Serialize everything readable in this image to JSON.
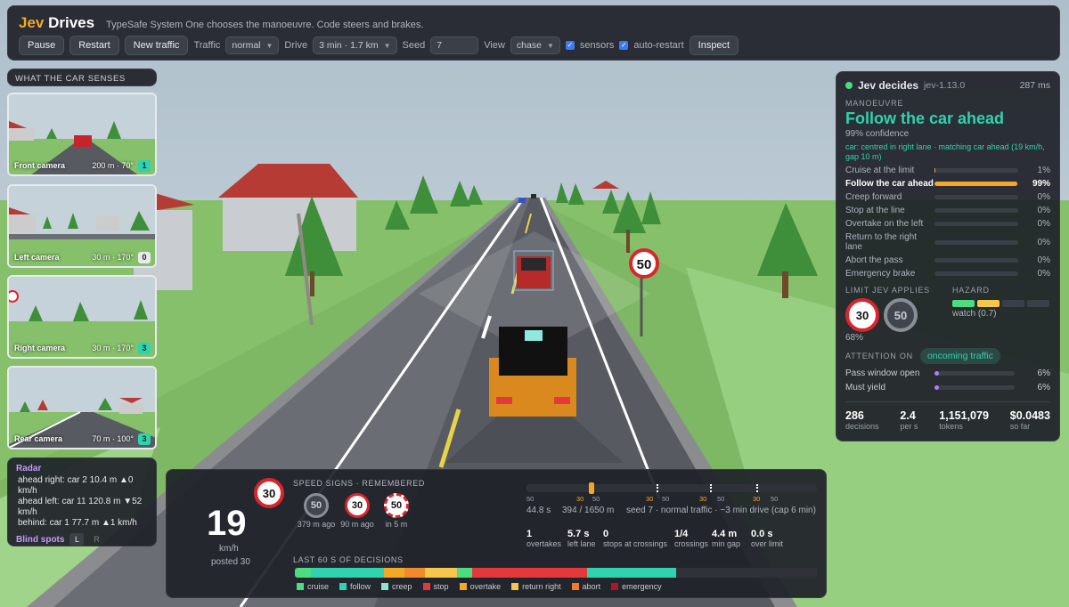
{
  "app": {
    "brand_jev": "Jev",
    "brand_drives": "Drives",
    "subtitle": "TypeSafe System One chooses the manoeuvre. Code steers and brakes."
  },
  "toolbar": {
    "pause": "Pause",
    "restart": "Restart",
    "new_traffic": "New traffic",
    "traffic_label": "Traffic",
    "traffic_value": "normal",
    "drive_label": "Drive",
    "drive_value": "3 min · 1.7 km",
    "seed_label": "Seed",
    "seed_value": "7",
    "view_label": "View",
    "view_value": "chase",
    "sensors_label": "sensors",
    "autorestart_label": "auto-restart",
    "inspect": "Inspect"
  },
  "senses": {
    "title": "WHAT THE CAR SENSES",
    "cameras": [
      {
        "label": "Front camera",
        "dist": "200 m · 70°",
        "count": "1",
        "count_color": "#2fd3b0"
      },
      {
        "label": "Left camera",
        "dist": "30 m · 170°",
        "count": "0",
        "count_color": "#e8eaed"
      },
      {
        "label": "Right camera",
        "dist": "30 m · 170°",
        "count": "3",
        "count_color": "#2fd3b0"
      },
      {
        "label": "Rear camera",
        "dist": "70 m · 100°",
        "count": "3",
        "count_color": "#2fd3b0"
      }
    ]
  },
  "radar": {
    "title": "Radar",
    "lines": [
      "ahead right: car 2 10.4 m ▲0 km/h",
      "ahead left: car 11 120.8 m ▼52 km/h",
      "behind: car 1 77.7 m ▲1 km/h"
    ],
    "blind_title": "Blind spots",
    "blind_left": "L",
    "blind_right": "R"
  },
  "decide": {
    "title": "Jev decides",
    "version": "jev-1.13.0",
    "latency": "287 ms",
    "manoeuvre_label": "MANOEUVRE",
    "manoeuvre": "Follow the car ahead",
    "confidence": "99% confidence",
    "detail": "car: centred in right lane · matching car ahead (19 km/h, gap 10 m)",
    "options": [
      {
        "name": "Cruise at the limit",
        "pct": "1%",
        "value": 0.01,
        "active": false
      },
      {
        "name": "Follow the car ahead",
        "pct": "99%",
        "value": 0.99,
        "active": true
      },
      {
        "name": "Creep forward",
        "pct": "0%",
        "value": 0,
        "active": false
      },
      {
        "name": "Stop at the line",
        "pct": "0%",
        "value": 0,
        "active": false
      },
      {
        "name": "Overtake on the left",
        "pct": "0%",
        "value": 0,
        "active": false
      },
      {
        "name": "Return to the right lane",
        "pct": "0%",
        "value": 0,
        "active": false
      },
      {
        "name": "Abort the pass",
        "pct": "0%",
        "value": 0,
        "active": false
      },
      {
        "name": "Emergency brake",
        "pct": "0%",
        "value": 0,
        "active": false
      }
    ],
    "limit_label": "LIMIT JEV APPLIES",
    "limit_value": "30",
    "limit_alt": "50",
    "limit_conf": "68%",
    "hazard_label": "HAZARD",
    "hazard_text": "watch (0.7)",
    "hazard_segments": [
      "#4ade80",
      "#f5c84c",
      "#3a3f48",
      "#3a3f48"
    ],
    "attention_label": "ATTENTION ON",
    "attention_value": "oncoming traffic",
    "subs": [
      {
        "name": "Pass window open",
        "pct": "6%",
        "value": 0.06
      },
      {
        "name": "Must yield",
        "pct": "6%",
        "value": 0.06
      }
    ],
    "stats": [
      {
        "v": "286",
        "l": "decisions"
      },
      {
        "v": "2.4",
        "l": "per s"
      },
      {
        "v": "1,151,079",
        "l": "tokens"
      },
      {
        "v": "$0.0483",
        "l": "so far"
      }
    ]
  },
  "hud": {
    "speed": "19",
    "unit": "km/h",
    "posted": "posted 30",
    "sign": "30",
    "remembered_label": "SPEED SIGNS · REMEMBERED",
    "remembered": [
      {
        "value": "50",
        "when": "379 m ago",
        "style": "grey"
      },
      {
        "value": "30",
        "when": "90 m ago",
        "style": "red"
      },
      {
        "value": "50",
        "when": "in 5 m",
        "style": "dashed"
      }
    ],
    "track_labels": [
      "50",
      "30",
      "50",
      "30",
      "50",
      "30",
      "50",
      "30",
      "50"
    ],
    "time": "44.8 s",
    "distance": "394 / 1650 m",
    "info": "seed 7 · normal traffic · ~3 min drive (cap 6 min)",
    "metrics": [
      {
        "v": "1",
        "l": "overtakes"
      },
      {
        "v": "5.7 s",
        "l": "left lane"
      },
      {
        "v": "0",
        "l": "stops at crossings"
      },
      {
        "v": "1/4",
        "l": "crossings"
      },
      {
        "v": "4.4 m",
        "l": "min gap"
      },
      {
        "v": "0.0 s",
        "l": "over limit"
      }
    ],
    "last60_label": "LAST 60 S OF DECISIONS",
    "timeline": [
      {
        "kind": "cruise",
        "frac": 0.03
      },
      {
        "kind": "follow",
        "frac": 0.14
      },
      {
        "kind": "overtake",
        "frac": 0.04
      },
      {
        "kind": "overtake2",
        "frac": 0.04
      },
      {
        "kind": "return right",
        "frac": 0.06
      },
      {
        "kind": "cruise",
        "frac": 0.03
      },
      {
        "kind": "stop",
        "frac": 0.22
      },
      {
        "kind": "follow",
        "frac": 0.17
      },
      {
        "kind": "empty",
        "frac": 0.27
      }
    ],
    "legend": [
      {
        "name": "cruise",
        "color": "#4ade80"
      },
      {
        "name": "follow",
        "color": "#2fd3b0"
      },
      {
        "name": "creep",
        "color": "#8fe3d0"
      },
      {
        "name": "stop",
        "color": "#e5383b"
      },
      {
        "name": "overtake",
        "color": "#f3a826"
      },
      {
        "name": "return right",
        "color": "#f5c84c"
      },
      {
        "name": "abort",
        "color": "#f07a30"
      },
      {
        "name": "emergency",
        "color": "#b0162a"
      }
    ]
  },
  "road_sign": "50"
}
